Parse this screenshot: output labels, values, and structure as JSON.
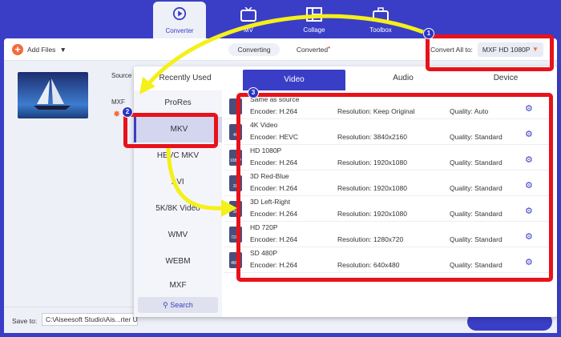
{
  "nav": {
    "tabs": [
      {
        "label": "Converter",
        "icon": "converter-icon"
      },
      {
        "label": "MV",
        "icon": "tv-icon"
      },
      {
        "label": "Collage",
        "icon": "collage-icon"
      },
      {
        "label": "Toolbox",
        "icon": "toolbox-icon"
      }
    ]
  },
  "toolbar": {
    "add_files": "Add Files",
    "converting": "Converting",
    "converted": "Converted",
    "convert_all_label": "Convert All to:",
    "convert_all_value": "MXF HD 1080P"
  },
  "file": {
    "source_label": "Source",
    "format_label": "MXF"
  },
  "panel": {
    "tabs": [
      "Recently Used",
      "Video",
      "Audio",
      "Device"
    ],
    "active_tab": "Video",
    "formats": [
      "ProRes",
      "MKV",
      "HEVC MKV",
      "AVI",
      "5K/8K Video",
      "WMV",
      "WEBM",
      "MXF"
    ],
    "active_format": "MKV",
    "search_label": "Search",
    "presets": [
      {
        "name": "Same as source",
        "encoder": "Encoder: H.264",
        "resolution": "Resolution: Keep Original",
        "quality": "Quality: Auto",
        "icon_text": ""
      },
      {
        "name": "4K Video",
        "encoder": "Encoder: HEVC",
        "resolution": "Resolution: 3840x2160",
        "quality": "Quality: Standard",
        "icon_text": "4K"
      },
      {
        "name": "HD 1080P",
        "encoder": "Encoder: H.264",
        "resolution": "Resolution: 1920x1080",
        "quality": "Quality: Standard",
        "icon_text": "1080P"
      },
      {
        "name": "3D Red-Blue",
        "encoder": "Encoder: H.264",
        "resolution": "Resolution: 1920x1080",
        "quality": "Quality: Standard",
        "icon_text": "3D"
      },
      {
        "name": "3D Left-Right",
        "encoder": "Encoder: H.264",
        "resolution": "Resolution: 1920x1080",
        "quality": "Quality: Standard",
        "icon_text": "3D"
      },
      {
        "name": "HD 720P",
        "encoder": "Encoder: H.264",
        "resolution": "Resolution: 1280x720",
        "quality": "Quality: Standard",
        "icon_text": "720P"
      },
      {
        "name": "SD 480P",
        "encoder": "Encoder: H.264",
        "resolution": "Resolution: 640x480",
        "quality": "Quality: Standard",
        "icon_text": "480P"
      }
    ]
  },
  "save": {
    "label": "Save to:",
    "path": "C:\\Aiseesoft Studio\\Ais...rter U"
  },
  "annotations": {
    "badges": [
      "1",
      "2",
      "3"
    ],
    "highlight_color": "#e8121a",
    "arrow_color": "#f4f01a",
    "badge_color": "#2a35c4"
  },
  "colors": {
    "brand": "#3a3ec6",
    "accent": "#f36b3d"
  }
}
